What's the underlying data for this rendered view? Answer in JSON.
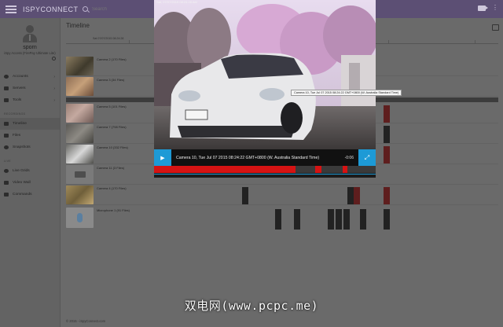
{
  "app": {
    "brand": "ISPYCONNECT"
  },
  "search": {
    "placeholder": "Search"
  },
  "user": {
    "name": "sporn",
    "subtitle": "iSpy Access (FirePay Ultimate Lite)"
  },
  "nav": {
    "items": [
      {
        "label": "Accounts",
        "icon": "users-icon"
      },
      {
        "label": "Servers",
        "icon": "server-icon"
      },
      {
        "label": "Tools",
        "icon": "tools-icon"
      }
    ],
    "section1": "RECORDINGS",
    "recordings": [
      {
        "label": "Timeline",
        "icon": "timeline-icon",
        "active": true
      },
      {
        "label": "Files",
        "icon": "folder-icon"
      },
      {
        "label": "Snapshots",
        "icon": "camera-icon"
      }
    ],
    "section2": "LIVE",
    "live": [
      {
        "label": "Live Grids",
        "icon": "grid-icon"
      },
      {
        "label": "Video Wall",
        "icon": "wall-icon"
      },
      {
        "label": "Commands",
        "icon": "list-icon"
      }
    ]
  },
  "main": {
    "title": "Timeline",
    "ruler_label": "Sat 07/07/2015 08:24:28"
  },
  "rows": [
    {
      "label": "Camera 2 (170 Files)"
    },
    {
      "label": "Camera 3 (34 Files)"
    },
    {
      "label": "Camera 5 (101 Files)"
    },
    {
      "label": "Camera 7 (798 Files)"
    },
    {
      "label": "Camera 10 (332 Files)"
    },
    {
      "label": "Camera 11 (3 Files)"
    },
    {
      "label": "Camera 4 (170 Files)"
    },
    {
      "label": "Microphone 1 (91 Files)"
    }
  ],
  "video": {
    "timestamp": "Sat, 07/07/2015 08:24:28 AM",
    "caption": "Camera 10, Tue Jul 07 2015 08:24:22 GMT+0800 (W. Australia Standard Time)",
    "time": "-0:06",
    "progress_fraction": 0.64,
    "tooltip": "Camera 10, Tue Jul 07 2015 08:24:22 GMT+0800 (W. Australia Standard Time)"
  },
  "footer": "© 2015 - iSpyConnect.com",
  "watermark": "双电网(www.pcpc.me)",
  "colors": {
    "accent": "#1d9ad6",
    "topbar": "#5c4f74",
    "progress": "#d51313"
  }
}
